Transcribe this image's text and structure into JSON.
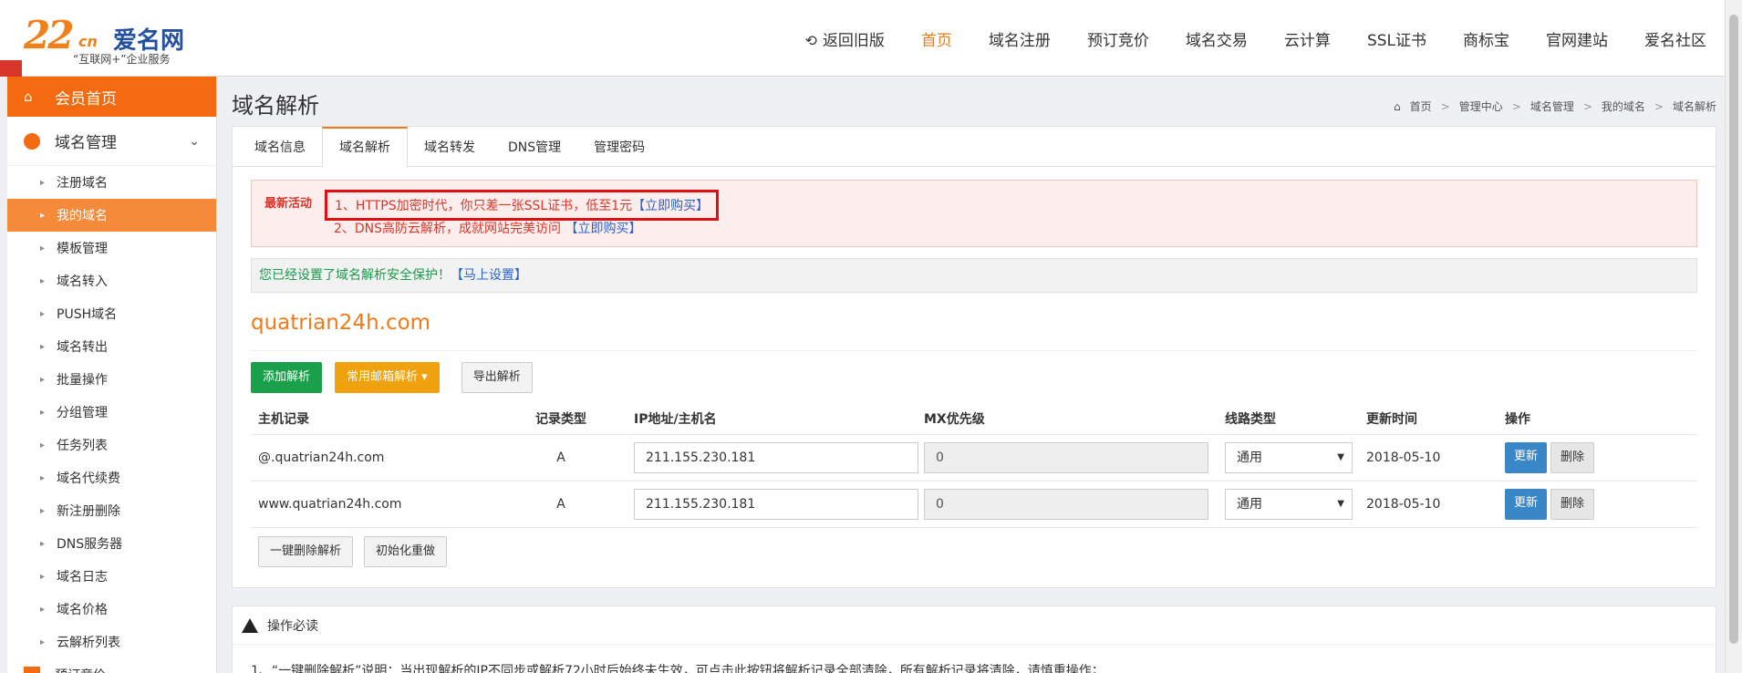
{
  "logo": {
    "number": "22",
    "suffix": "cn",
    "brand": "爱名网",
    "slogan": "“互联网+”企业服务"
  },
  "nav": {
    "back_label": "返回旧版",
    "items": [
      {
        "label": "首页",
        "active": true
      },
      {
        "label": "域名注册"
      },
      {
        "label": "预订竞价"
      },
      {
        "label": "域名交易"
      },
      {
        "label": "云计算"
      },
      {
        "label": "SSL证书"
      },
      {
        "label": "商标宝"
      },
      {
        "label": "官网建站"
      },
      {
        "label": "爱名社区"
      }
    ]
  },
  "sidebar": {
    "home": "会员首页",
    "group": "域名管理",
    "items": [
      "注册域名",
      "我的域名",
      "模板管理",
      "域名转入",
      "PUSH域名",
      "域名转出",
      "批量操作",
      "分组管理",
      "任务列表",
      "域名代续费",
      "新注册删除",
      "DNS服务器",
      "域名日志",
      "域名价格",
      "云解析列表"
    ],
    "active_index": 1,
    "next_group": "预订竞价"
  },
  "page": {
    "title": "域名解析",
    "breadcrumb": [
      "首页",
      "管理中心",
      "域名管理",
      "我的域名",
      "域名解析"
    ]
  },
  "tabs": [
    {
      "label": "域名信息"
    },
    {
      "label": "域名解析",
      "active": true
    },
    {
      "label": "域名转发"
    },
    {
      "label": "DNS管理"
    },
    {
      "label": "管理密码"
    }
  ],
  "promo": {
    "label": "最新活动",
    "line1_text": "1、HTTPS加密时代，你只差一张SSL证书，低至1元",
    "line1_link": "【立即购买】",
    "line2_text": "2、DNS高防云解析，成就网站完美访问",
    "line2_link": "【立即购买】"
  },
  "secure": {
    "text": "您已经设置了域名解析安全保护！",
    "link": "【马上设置】"
  },
  "domain": "quatrian24h.com",
  "buttons": {
    "add": "添加解析",
    "mail": "常用邮箱解析",
    "export": "导出解析",
    "delete_all": "一键删除解析",
    "reset": "初始化重做"
  },
  "table": {
    "headers": [
      "主机记录",
      "记录类型",
      "IP地址/主机名",
      "MX优先级",
      "线路类型",
      "更新时间",
      "操作"
    ],
    "rows": [
      {
        "host": "@.quatrian24h.com",
        "type": "A",
        "ip": "211.155.230.181",
        "mx": "0",
        "line": "通用",
        "date": "2018-05-10",
        "update": "更新",
        "delete": "删除"
      },
      {
        "host": "www.quatrian24h.com",
        "type": "A",
        "ip": "211.155.230.181",
        "mx": "0",
        "line": "通用",
        "date": "2018-05-10",
        "update": "更新",
        "delete": "删除"
      }
    ]
  },
  "notice": {
    "title": "操作必读",
    "line1": "1、“一键删除解析”说明：当出现解析的IP不同步或解析72小时后始终未生效，可点击此按钮将解析记录全部清除，所有解析记录将清除，请慎重操作；"
  },
  "colors": {
    "accent": "#f07a1a",
    "sidebar_active": "#f58a3a",
    "primary": "#3a87c8",
    "success": "#1aa04a"
  }
}
